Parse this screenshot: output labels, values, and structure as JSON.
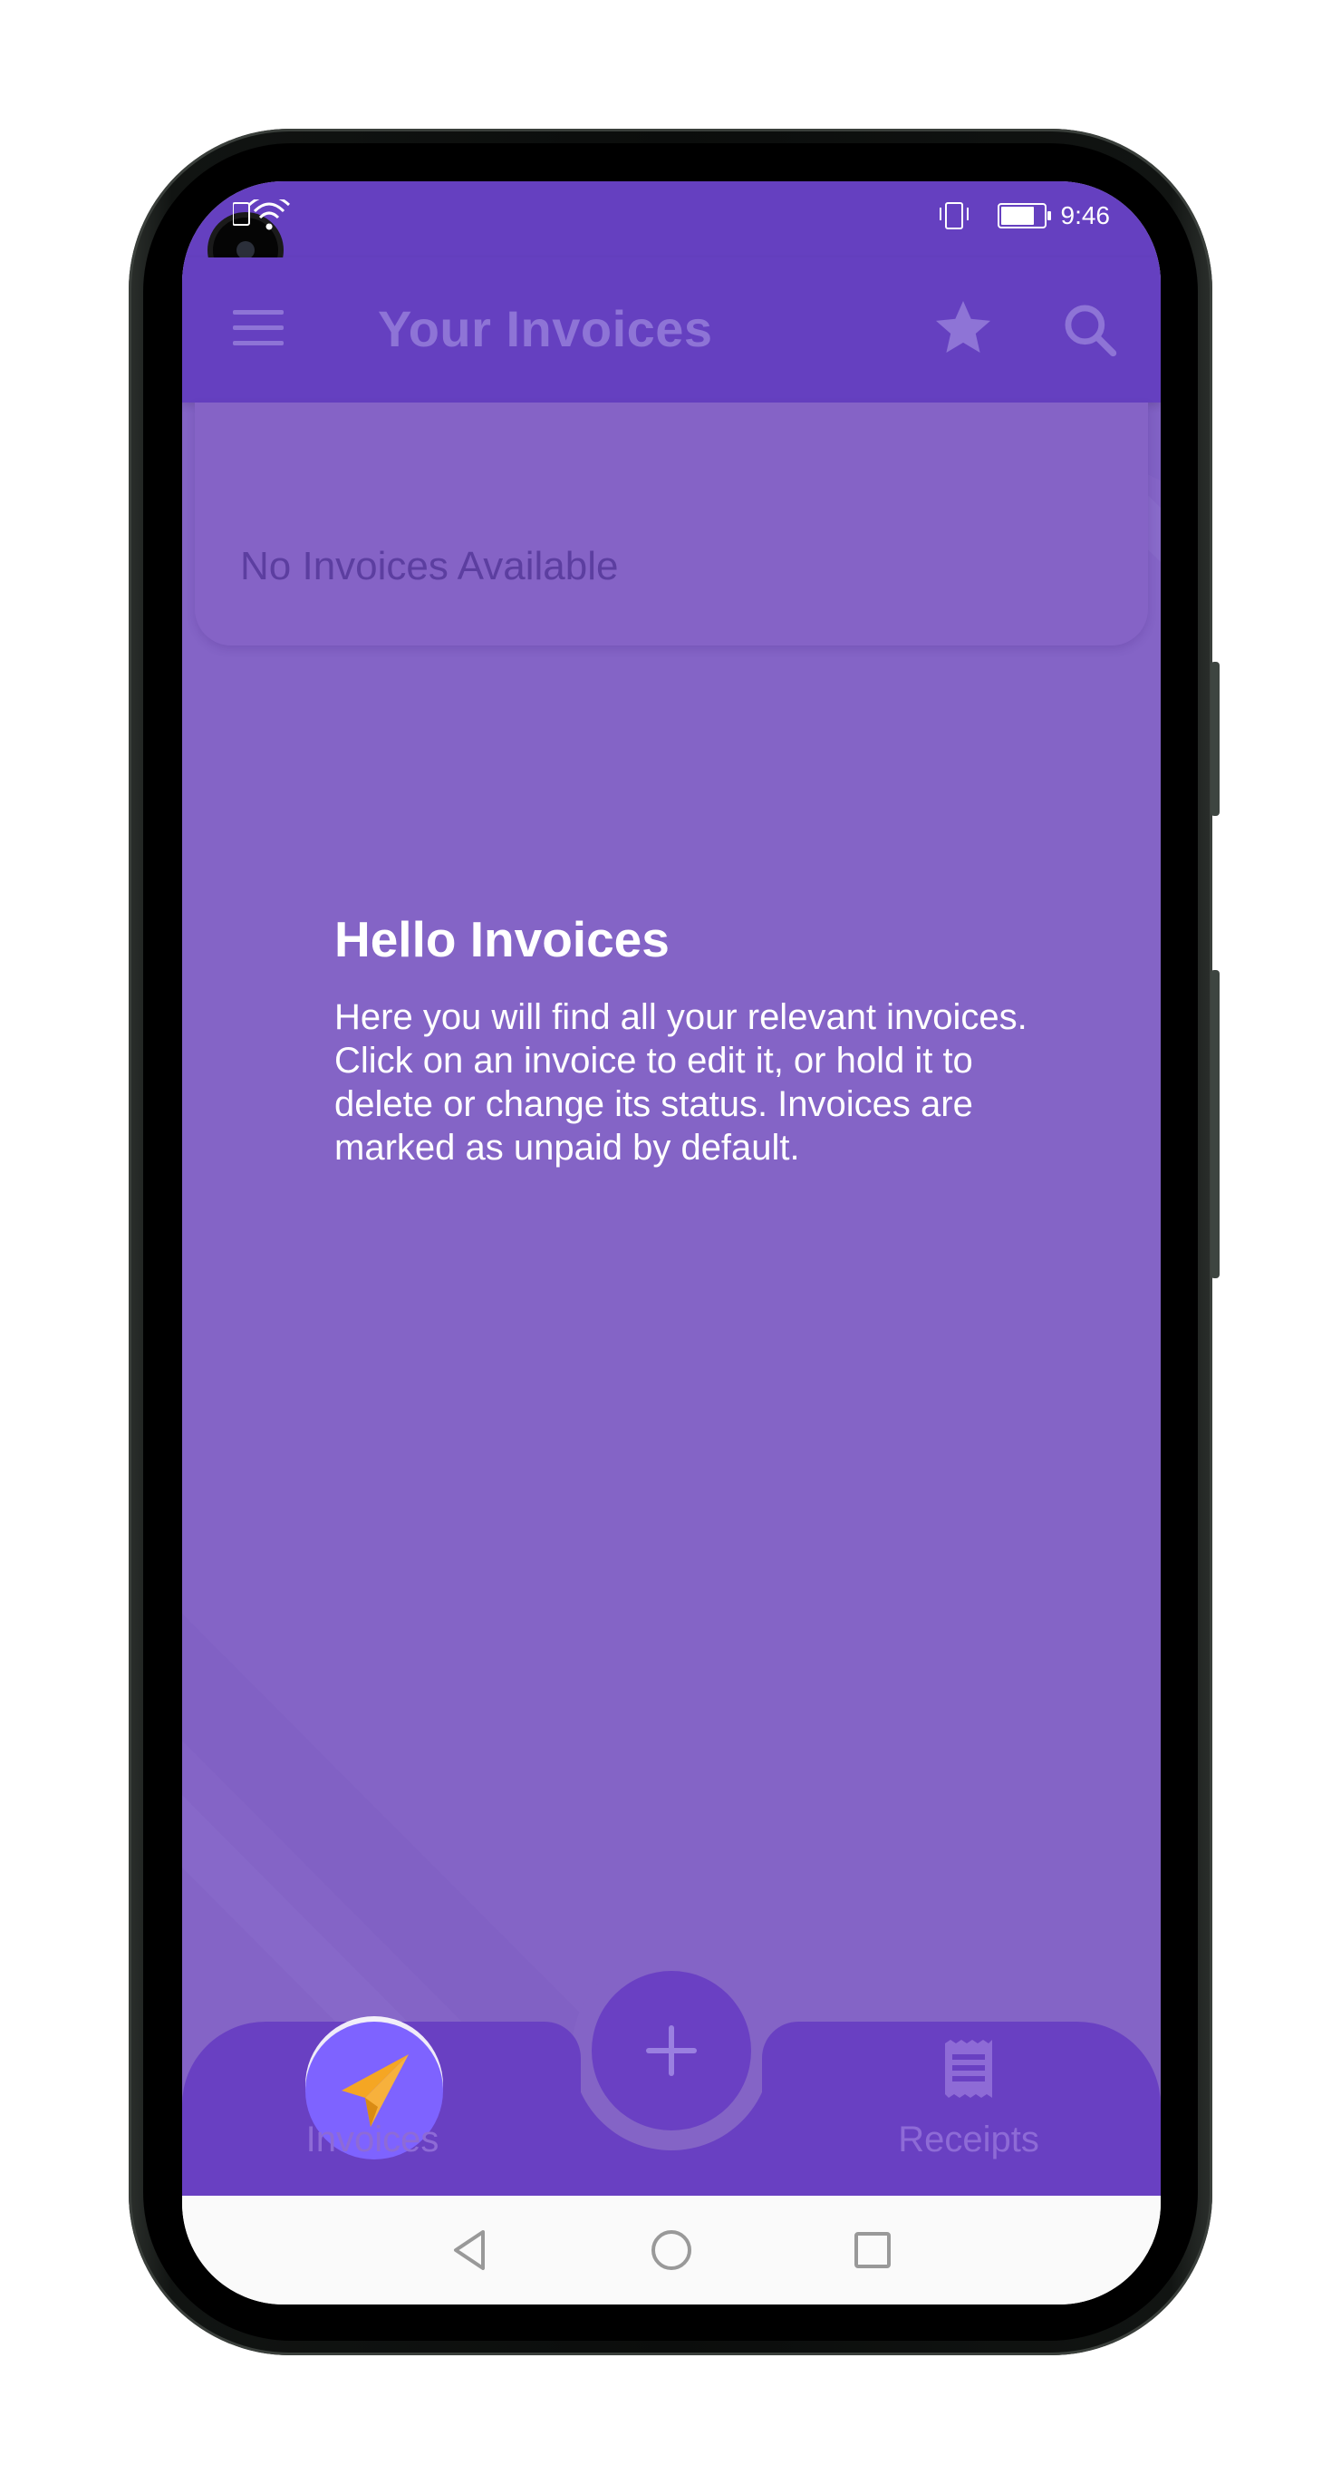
{
  "status_bar": {
    "time": "9:46",
    "icons": [
      "sim-icon",
      "wifi-icon",
      "vibrate-icon",
      "battery-charging-icon"
    ]
  },
  "app_bar": {
    "title": "Your Invoices",
    "icons": [
      "menu-icon",
      "star-icon",
      "search-icon"
    ]
  },
  "empty_state": {
    "message": "No Invoices Available"
  },
  "onboarding": {
    "title": "Hello Invoices",
    "body": "Here you will find all your relevant invoices. Click on an invoice to edit it, or hold it to delete or change its status. Invoices are marked as unpaid by default."
  },
  "bottom_nav": {
    "items": [
      {
        "label": "Invoices",
        "icon": "paper-plane-icon",
        "active": true
      },
      {
        "label": "Receipts",
        "icon": "receipt-icon",
        "active": false
      }
    ],
    "fab_icon": "plus-icon"
  },
  "system_nav": {
    "buttons": [
      "back-icon",
      "home-icon",
      "recents-icon"
    ]
  },
  "colors": {
    "primary": "#6540c0",
    "background": "#8464c6",
    "accent": "#f5a623",
    "active_bubble": "#7e63ff"
  }
}
